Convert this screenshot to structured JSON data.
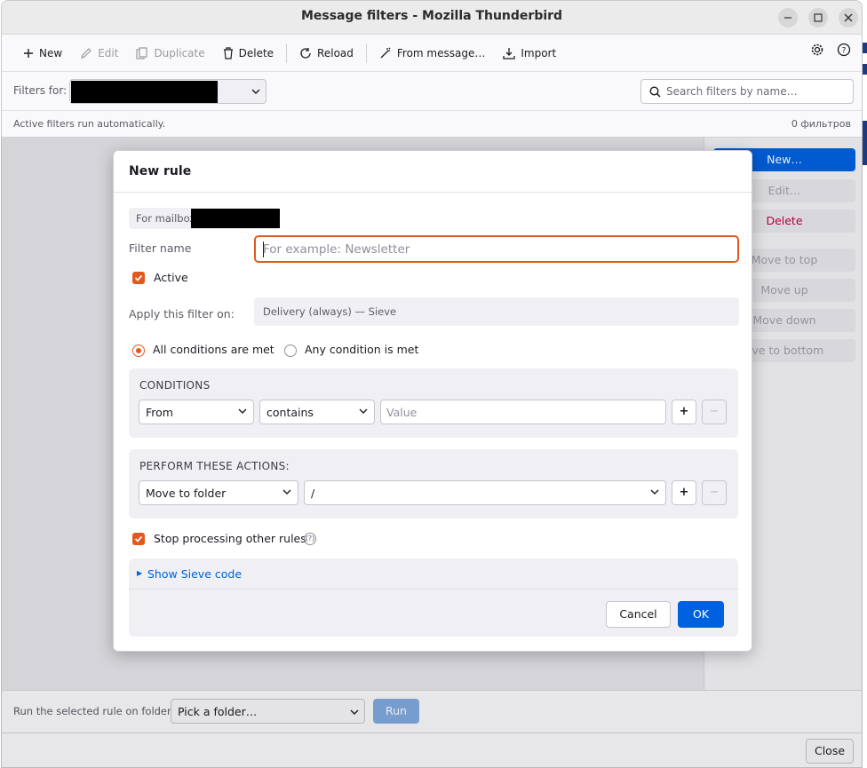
{
  "window": {
    "title": "Message filters - Mozilla Thunderbird"
  },
  "toolbar": {
    "new_label": "New",
    "edit_label": "Edit",
    "duplicate_label": "Duplicate",
    "delete_label": "Delete",
    "reload_label": "Reload",
    "from_message_label": "From message…",
    "import_label": "Import"
  },
  "filterbar": {
    "label": "Filters for:",
    "search_placeholder": "Search filters by name…"
  },
  "status": {
    "text": "Active filters run automatically.",
    "count": "0 фильтров"
  },
  "rightpane": {
    "new": "New…",
    "edit": "Edit…",
    "delete": "Delete",
    "move_top": "Move to top",
    "move_up": "Move up",
    "move_down": "Move down",
    "move_bottom": "ove to bottom"
  },
  "bottombar": {
    "label": "Run the selected rule on folder:",
    "folder_select": "Pick a folder…",
    "run": "Run"
  },
  "footer": {
    "close": "Close"
  },
  "dialog": {
    "title": "New rule",
    "mailbox_label": "For mailbox",
    "filter_name_label": "Filter name",
    "filter_name_placeholder": "For example: Newsletter",
    "active_label": "Active",
    "apply_label": "Apply this filter on:",
    "apply_value": "Delivery (always) — Sieve",
    "match_all": "All conditions are met",
    "match_any": "Any condition is met",
    "conditions_header": "CONDITIONS",
    "condition": {
      "field": "From",
      "operator": "contains",
      "value_placeholder": "Value"
    },
    "actions_header": "PERFORM THESE ACTIONS:",
    "action": {
      "type": "Move to folder",
      "folder": "/"
    },
    "plus": "+",
    "minus": "−",
    "stop_label": "Stop processing other rules",
    "help": "(?)",
    "show_sieve": "Show Sieve code",
    "cancel": "Cancel",
    "ok": "OK"
  },
  "colors": {
    "accent": "#e25920",
    "primary_button": "#0061e0",
    "danger_text": "#c50042"
  }
}
